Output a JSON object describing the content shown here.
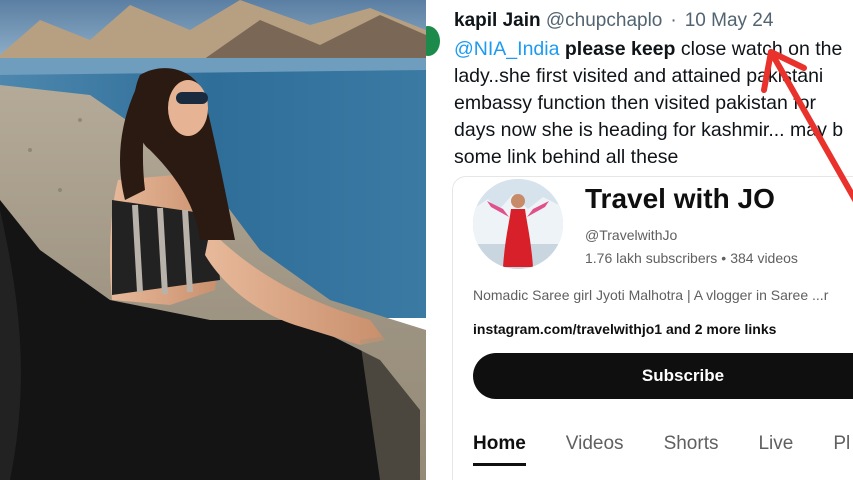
{
  "tweet": {
    "author_name": "kapil Jain",
    "author_handle": "@chupchaplo",
    "separator": "·",
    "date": "10 May 24",
    "more_glyph": "(",
    "line1_mention": "@NIA_India",
    "line1_bold": "please keep",
    "line1_rest": "close watch on the",
    "line2": "lady..she first visited and attained pakistani",
    "line3": "embassy function then visited pakistan for",
    "line4": "days now she is heading for kashmir... may b",
    "line5": "some link behind all these"
  },
  "youtube": {
    "channel_title": "Travel with JO",
    "handle": "@TravelwithJo",
    "subscribers": "1.76 lakh subscribers",
    "dot": "•",
    "videos": "384 videos",
    "description": "Nomadic Saree girl Jyoti Malhotra | A vlogger in Saree ...r",
    "links": "instagram.com/travelwithjo1 and 2 more links",
    "subscribe_label": "Subscribe",
    "tabs": [
      "Home",
      "Videos",
      "Shorts",
      "Live",
      "Pl"
    ]
  },
  "colors": {
    "mention": "#1d9bf0",
    "annotation_arrow": "#e8322b",
    "subscribe_bg": "#0f0f0f"
  }
}
